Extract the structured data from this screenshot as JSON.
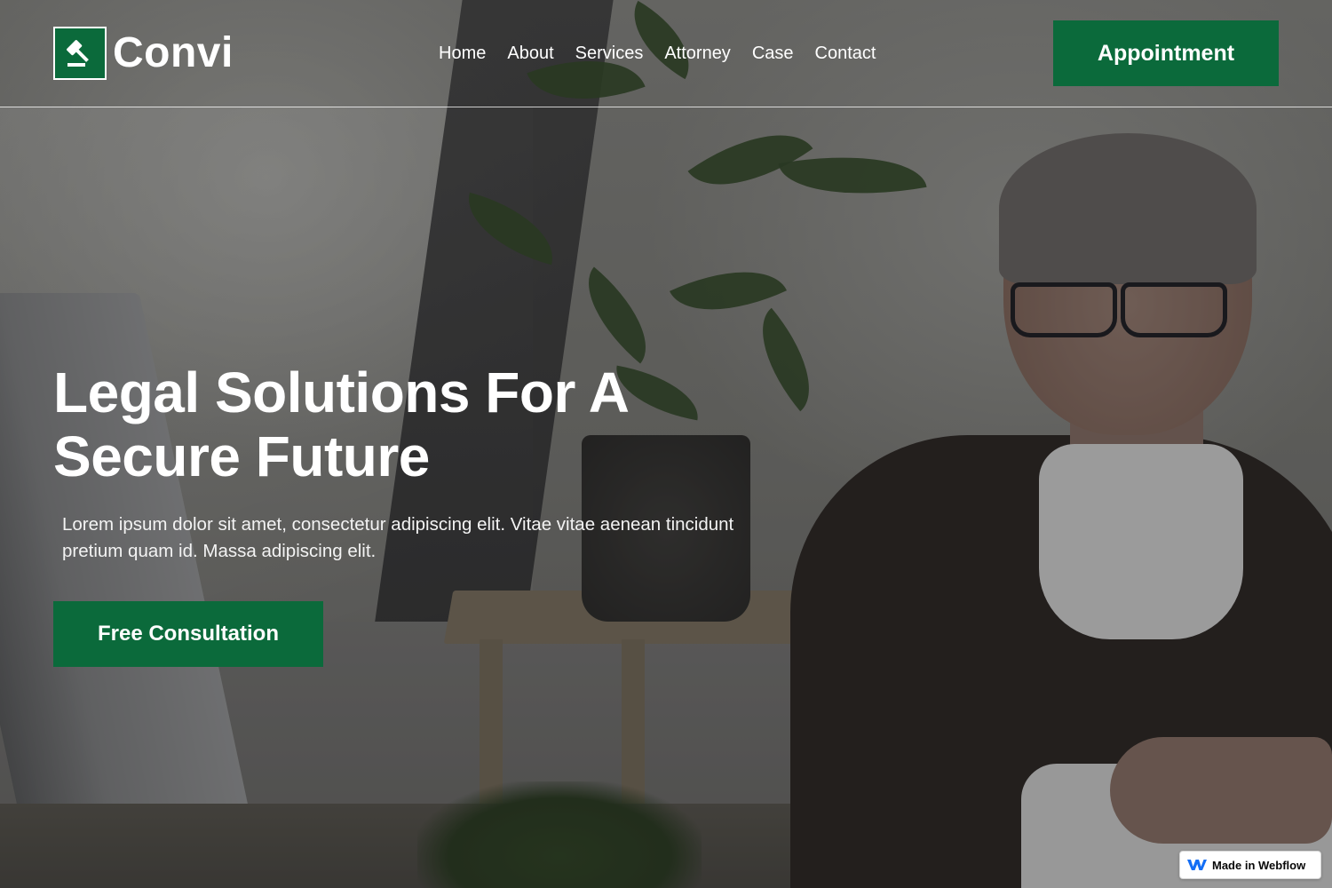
{
  "brand": {
    "name": "Convi",
    "icon": "gavel-icon",
    "color": "#0b6a3b"
  },
  "nav": {
    "items": [
      {
        "label": "Home"
      },
      {
        "label": "About"
      },
      {
        "label": "Services"
      },
      {
        "label": "Attorney"
      },
      {
        "label": "Case"
      },
      {
        "label": "Contact"
      }
    ],
    "cta_label": "Appointment"
  },
  "hero": {
    "title_line1": "Legal Solutions For  A",
    "title_line2": "Secure Future",
    "description": "Lorem ipsum dolor sit amet, consectetur adipiscing elit. Vitae vitae aenean tincidunt pretium quam id. Massa  adipiscing elit.",
    "cta_label": "Free Consultation"
  },
  "badge": {
    "label": "Made in Webflow",
    "icon": "webflow-icon"
  }
}
